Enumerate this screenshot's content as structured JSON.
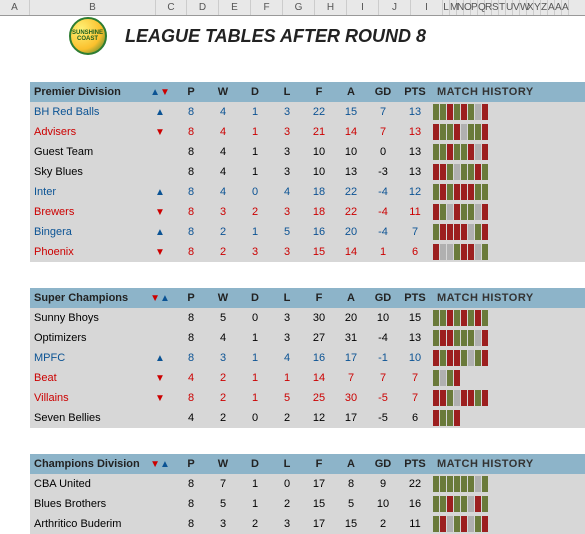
{
  "title": "LEAGUE TABLES AFTER ROUND 8",
  "col_letters": [
    "A",
    "B",
    "C",
    "D",
    "E",
    "F",
    "G",
    "H",
    "I",
    "J",
    "I",
    "L",
    "M",
    "N",
    "O",
    "P",
    "Q",
    "R",
    "S",
    "T",
    "U",
    "V",
    "W",
    "X",
    "Y",
    "Z",
    "A",
    "A",
    "A"
  ],
  "col_widths_main": [
    30,
    126,
    31,
    32,
    32,
    32,
    32,
    32,
    32,
    32,
    32
  ],
  "small_col_w": 7,
  "stat_cols": [
    "P",
    "W",
    "D",
    "L",
    "F",
    "A",
    "GD",
    "PTS"
  ],
  "history_label": "MATCH HISTORY",
  "arrows_header_ud": "▲▼",
  "arrows_header_du": "▼▲",
  "divisions": [
    {
      "name": "Premier Division",
      "arrow_order": "ud",
      "teams": [
        {
          "name": "BH Red Balls",
          "move": "up",
          "color": "blue",
          "P": 8,
          "W": 4,
          "D": 1,
          "L": 3,
          "F": 22,
          "A": 15,
          "GD": 7,
          "PTS": 13,
          "hist": [
            "w",
            "w",
            "l",
            "w",
            "l",
            "w",
            "d",
            "l"
          ]
        },
        {
          "name": "Advisers",
          "move": "down",
          "color": "red",
          "P": 8,
          "W": 4,
          "D": 1,
          "L": 3,
          "F": 21,
          "A": 14,
          "GD": 7,
          "PTS": 13,
          "hist": [
            "l",
            "w",
            "w",
            "l",
            "d",
            "w",
            "w",
            "l"
          ]
        },
        {
          "name": "Guest Team",
          "move": "",
          "color": "black",
          "P": 8,
          "W": 4,
          "D": 1,
          "L": 3,
          "F": 10,
          "A": 10,
          "GD": 0,
          "PTS": 13,
          "hist": [
            "w",
            "w",
            "l",
            "w",
            "w",
            "l",
            "d",
            "l"
          ]
        },
        {
          "name": "Sky Blues",
          "move": "",
          "color": "black",
          "P": 8,
          "W": 4,
          "D": 1,
          "L": 3,
          "F": 10,
          "A": 13,
          "GD": -3,
          "PTS": 13,
          "hist": [
            "l",
            "l",
            "w",
            "d",
            "w",
            "w",
            "l",
            "w"
          ]
        },
        {
          "name": "Inter",
          "move": "up",
          "color": "blue",
          "P": 8,
          "W": 4,
          "D": 0,
          "L": 4,
          "F": 18,
          "A": 22,
          "GD": -4,
          "PTS": 12,
          "hist": [
            "w",
            "l",
            "w",
            "l",
            "l",
            "l",
            "w",
            "w"
          ]
        },
        {
          "name": "Brewers",
          "move": "down",
          "color": "red",
          "P": 8,
          "W": 3,
          "D": 2,
          "L": 3,
          "F": 18,
          "A": 22,
          "GD": -4,
          "PTS": 11,
          "hist": [
            "l",
            "w",
            "d",
            "l",
            "w",
            "w",
            "d",
            "l"
          ]
        },
        {
          "name": "Bingera",
          "move": "up",
          "color": "blue",
          "P": 8,
          "W": 2,
          "D": 1,
          "L": 5,
          "F": 16,
          "A": 20,
          "GD": -4,
          "PTS": 7,
          "hist": [
            "w",
            "l",
            "l",
            "l",
            "l",
            "d",
            "w",
            "l"
          ]
        },
        {
          "name": "Phoenix",
          "move": "down",
          "color": "red",
          "P": 8,
          "W": 2,
          "D": 3,
          "L": 3,
          "F": 15,
          "A": 14,
          "GD": 1,
          "PTS": 6,
          "hist": [
            "l",
            "d",
            "d",
            "w",
            "l",
            "l",
            "d",
            "w"
          ]
        }
      ]
    },
    {
      "name": "Super Champions",
      "arrow_order": "du",
      "teams": [
        {
          "name": "Sunny Bhoys",
          "move": "",
          "color": "black",
          "P": 8,
          "W": 5,
          "D": 0,
          "L": 3,
          "F": 30,
          "A": 20,
          "GD": 10,
          "PTS": 15,
          "hist": [
            "w",
            "w",
            "l",
            "w",
            "l",
            "w",
            "l",
            "w"
          ]
        },
        {
          "name": "Optimizers",
          "move": "",
          "color": "black",
          "P": 8,
          "W": 4,
          "D": 1,
          "L": 3,
          "F": 27,
          "A": 31,
          "GD": -4,
          "PTS": 13,
          "hist": [
            "w",
            "l",
            "l",
            "w",
            "w",
            "w",
            "d",
            "l"
          ]
        },
        {
          "name": "MPFC",
          "move": "up",
          "color": "blue",
          "P": 8,
          "W": 3,
          "D": 1,
          "L": 4,
          "F": 16,
          "A": 17,
          "GD": -1,
          "PTS": 10,
          "hist": [
            "l",
            "w",
            "l",
            "l",
            "w",
            "d",
            "w",
            "l"
          ]
        },
        {
          "name": "Beat",
          "move": "down",
          "color": "red",
          "P": 4,
          "W": 2,
          "D": 1,
          "L": 1,
          "F": 14,
          "A": 7,
          "GD": 7,
          "PTS": 7,
          "hist": [
            "w",
            "d",
            "w",
            "l",
            "e",
            "e",
            "e",
            "e"
          ]
        },
        {
          "name": "Villains",
          "move": "down",
          "color": "red",
          "P": 8,
          "W": 2,
          "D": 1,
          "L": 5,
          "F": 25,
          "A": 30,
          "GD": -5,
          "PTS": 7,
          "hist": [
            "l",
            "l",
            "w",
            "d",
            "l",
            "l",
            "w",
            "l"
          ]
        },
        {
          "name": "Seven Bellies",
          "move": "",
          "color": "black",
          "P": 4,
          "W": 2,
          "D": 0,
          "L": 2,
          "F": 12,
          "A": 17,
          "GD": -5,
          "PTS": 6,
          "hist": [
            "l",
            "w",
            "w",
            "l",
            "e",
            "e",
            "e",
            "e"
          ]
        }
      ]
    },
    {
      "name": "Champions Division",
      "arrow_order": "du",
      "teams": [
        {
          "name": "CBA United",
          "move": "",
          "color": "black",
          "P": 8,
          "W": 7,
          "D": 1,
          "L": 0,
          "F": 17,
          "A": 8,
          "GD": 9,
          "PTS": 22,
          "hist": [
            "w",
            "w",
            "w",
            "w",
            "w",
            "w",
            "d",
            "w"
          ]
        },
        {
          "name": "Blues Brothers",
          "move": "",
          "color": "black",
          "P": 8,
          "W": 5,
          "D": 1,
          "L": 2,
          "F": 15,
          "A": 5,
          "GD": 10,
          "PTS": 16,
          "hist": [
            "w",
            "w",
            "l",
            "w",
            "w",
            "d",
            "l",
            "w"
          ]
        },
        {
          "name": "Arthritico Buderim",
          "move": "",
          "color": "black",
          "P": 8,
          "W": 3,
          "D": 2,
          "L": 3,
          "F": 17,
          "A": 15,
          "GD": 2,
          "PTS": 11,
          "hist": [
            "w",
            "l",
            "d",
            "w",
            "l",
            "d",
            "w",
            "l"
          ]
        }
      ]
    }
  ]
}
